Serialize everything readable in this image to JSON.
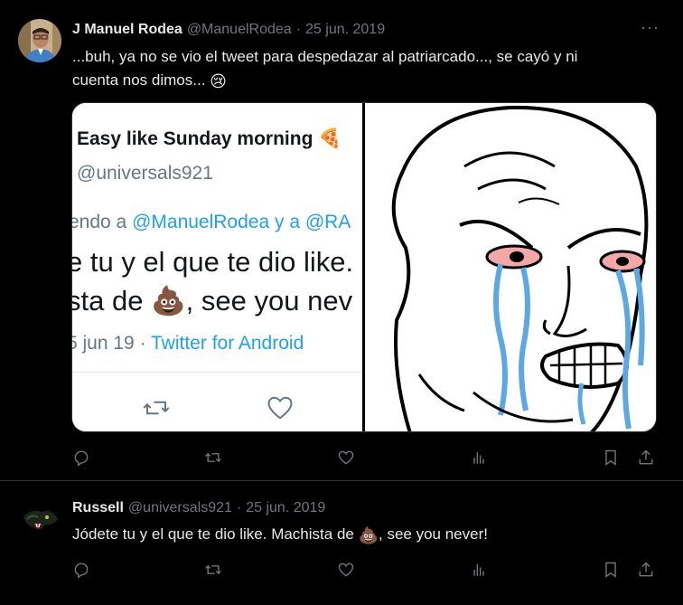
{
  "tweets": [
    {
      "name": "J Manuel Rodea",
      "handle": "@ManuelRodea",
      "separator": "·",
      "date": "25 jun. 2019",
      "more": "···",
      "text_line1": "...buh, ya no se vio el tweet para despedazar al patriarcado..., se cayó y ni",
      "text_line2": "cuenta nos dimos...",
      "emoji": "😢",
      "media": {
        "screenshot": {
          "name": "Easy like Sunday morning 🍕",
          "handle": "@universals921",
          "reply_prefix": "endo a ",
          "reply_link": "@ManuelRodea y a @RA",
          "body_line1": "e tu y el que te dio like.",
          "body_line2_a": "sta de ",
          "body_emoji": "💩",
          "body_line2_b": ", see you nev",
          "meta_date": "5 jun 19 · ",
          "meta_link": "Twitter for Android"
        },
        "meme": "crying wojak face"
      },
      "icons": [
        "reply-icon",
        "retweet-icon",
        "like-icon",
        "views-icon",
        "bookmark-icon",
        "share-icon"
      ]
    },
    {
      "name": "Russell",
      "handle": "@universals921",
      "separator": "·",
      "date": "25 jun. 2019",
      "text_a": "Jódete tu y el que te dio like. Machista de ",
      "emoji": "💩",
      "text_b": ", see you never!",
      "icons": [
        "reply-icon",
        "retweet-icon",
        "like-icon",
        "views-icon",
        "bookmark-icon",
        "share-icon"
      ]
    }
  ],
  "colors": {
    "background": "#000000",
    "text": "#e7e9ea",
    "muted": "#71767b",
    "border": "#2f3336",
    "link": "#1da1f2"
  }
}
